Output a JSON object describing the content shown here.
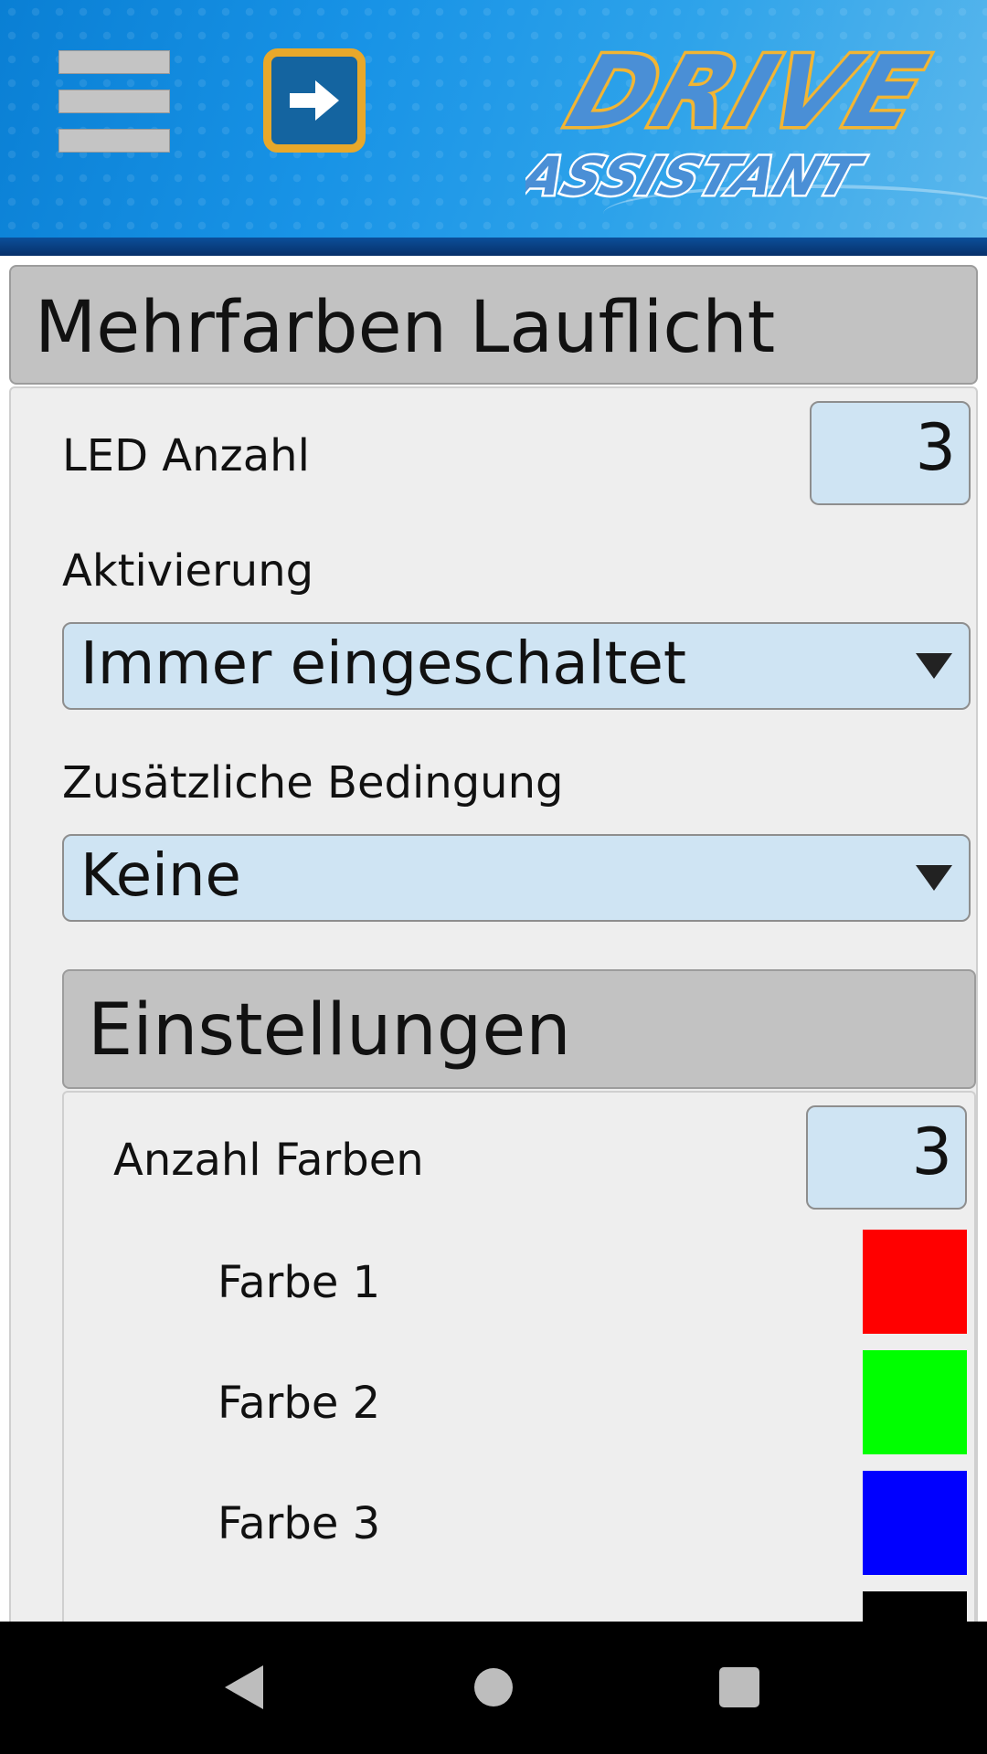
{
  "header": {
    "menu_icon": "hamburger-menu-icon",
    "forward_icon": "arrow-right-icon",
    "logo": {
      "line1": "DRIVE",
      "line2": "ASSISTANT"
    },
    "colors": {
      "header_blue": "#1893e6",
      "accent_orange": "#e8a82a",
      "button_blue": "#1464a0"
    }
  },
  "section": {
    "title": "Mehrfarben Lauflicht",
    "led_count": {
      "label": "LED Anzahl",
      "value": "3"
    },
    "activation": {
      "label": "Aktivierung",
      "selected": "Immer eingeschaltet"
    },
    "condition": {
      "label": "Zusätzliche Bedingung",
      "selected": "Keine"
    }
  },
  "settings": {
    "title": "Einstellungen",
    "color_count": {
      "label": "Anzahl Farben",
      "value": "3"
    },
    "colors": [
      {
        "label": "Farbe 1",
        "color": "#ff0000"
      },
      {
        "label": "Farbe 2",
        "color": "#00ff00"
      },
      {
        "label": "Farbe 3",
        "color": "#0000ff"
      },
      {
        "color": "#000000"
      }
    ]
  },
  "navbar": {
    "back_icon": "back-triangle-icon",
    "home_icon": "home-circle-icon",
    "recents_icon": "recents-square-icon"
  }
}
